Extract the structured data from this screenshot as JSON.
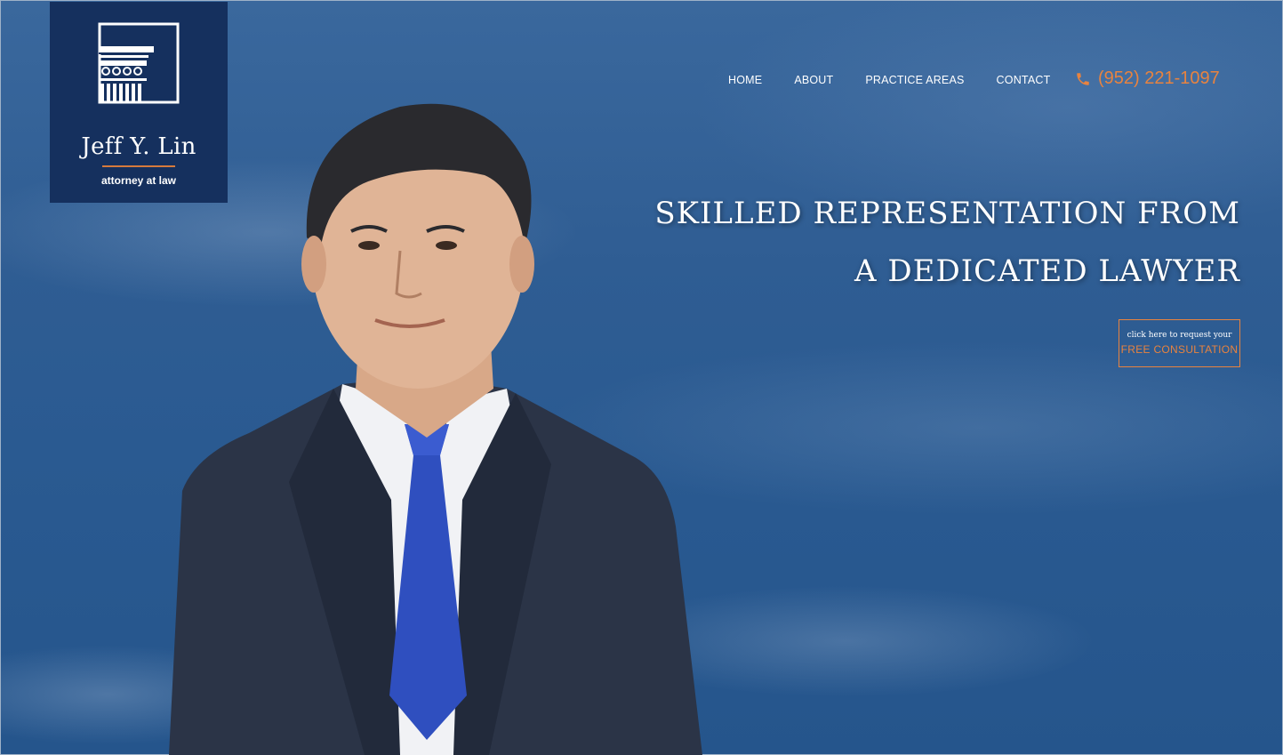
{
  "brand": {
    "name": "Jeff Y. Lin",
    "tagline": "attorney at law",
    "logo_icon": "column-icon"
  },
  "nav": {
    "items": [
      {
        "label": "HOME"
      },
      {
        "label": "ABOUT"
      },
      {
        "label": "PRACTICE AREAS"
      },
      {
        "label": "CONTACT"
      }
    ]
  },
  "phone": {
    "icon": "phone-icon",
    "number": "(952) 221-1097"
  },
  "hero": {
    "headline_line1": "SKILLED REPRESENTATION FROM",
    "headline_line2": "A DEDICATED LAWYER",
    "cta_small": "click here to request your",
    "cta_big": "FREE CONSULTATION"
  },
  "colors": {
    "accent": "#e8833f",
    "logo_bg": "#15305e",
    "sky": "#2f5d93"
  }
}
